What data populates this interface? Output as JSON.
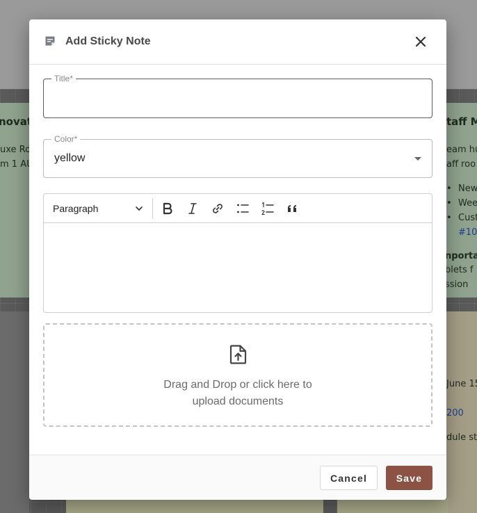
{
  "background": {
    "left_note": {
      "title": "novati",
      "lines": [
        "uxe Ro",
        "m 1 AU"
      ]
    },
    "right_note": {
      "title": "taff M",
      "lines": [
        "eam hu",
        "aff roo"
      ],
      "bullets": [
        "New",
        "Wee",
        "Cust"
      ],
      "link": "#10",
      "important": "nportan",
      "extra_lines": [
        "blets f",
        "ssion"
      ]
    },
    "right_note2": {
      "lines": [
        "June 15"
      ],
      "link": "200",
      "last": "dule st"
    }
  },
  "modal": {
    "title": "Add Sticky Note",
    "title_field": {
      "label": "Title*",
      "value": "",
      "placeholder": ""
    },
    "color_field": {
      "label": "Color*",
      "value": "yellow"
    },
    "editor": {
      "block_type": "Paragraph",
      "content": ""
    },
    "dropzone": {
      "text": "Drag and Drop or click here to upload documents"
    },
    "buttons": {
      "cancel": "Cancel",
      "save": "Save"
    }
  },
  "colors": {
    "save_button": "#8c5344",
    "overlay": "#9e9e9e"
  }
}
